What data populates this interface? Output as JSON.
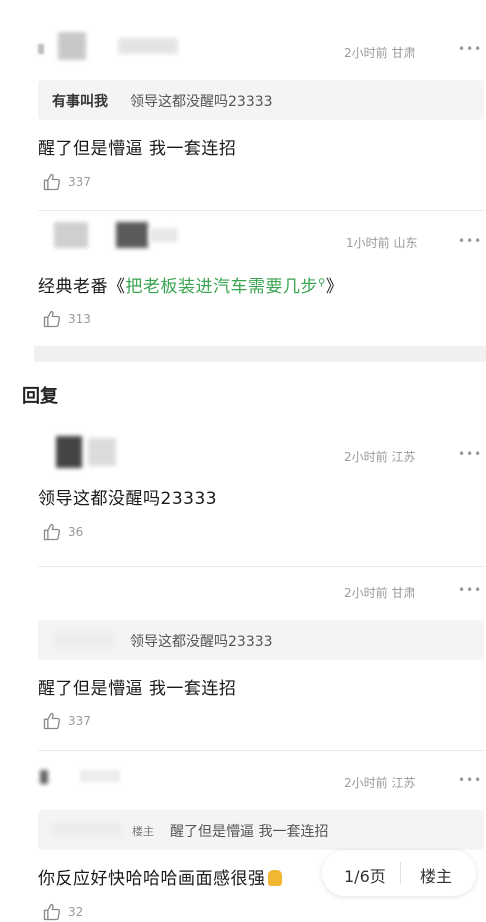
{
  "comments": [
    {
      "time": "2小时前",
      "location": "甘肃",
      "quote_name": "有事叫我",
      "quote_text": "领导这都没醒吗23333",
      "text": "醒了但是懵逼  我一套连招",
      "likes": "337"
    },
    {
      "time": "1小时前",
      "location": "山东",
      "text_prefix": "经典老番《",
      "link_text": "把老板装进汽车需要几步",
      "text_suffix": "》",
      "likes": "313"
    }
  ],
  "replies_section": {
    "title": "回复"
  },
  "replies": [
    {
      "time": "2小时前",
      "location": "江苏",
      "text": "领导这都没醒吗23333",
      "likes": "36"
    },
    {
      "time": "2小时前",
      "location": "甘肃",
      "quote_text": "领导这都没醒吗23333",
      "text": "醒了但是懵逼  我一套连招",
      "likes": "337"
    },
    {
      "time": "2小时前",
      "location": "江苏",
      "quote_badge": "楼主",
      "quote_text": "醒了但是懵逼  我一套连招",
      "text": "你反应好快哈哈哈画面感很强",
      "likes": "32"
    }
  ],
  "more_label": "•••",
  "pager": {
    "page": "1/6页",
    "op_label": "楼主"
  },
  "colors": {
    "link": "#3aa452",
    "meta": "#9a9a9a"
  }
}
